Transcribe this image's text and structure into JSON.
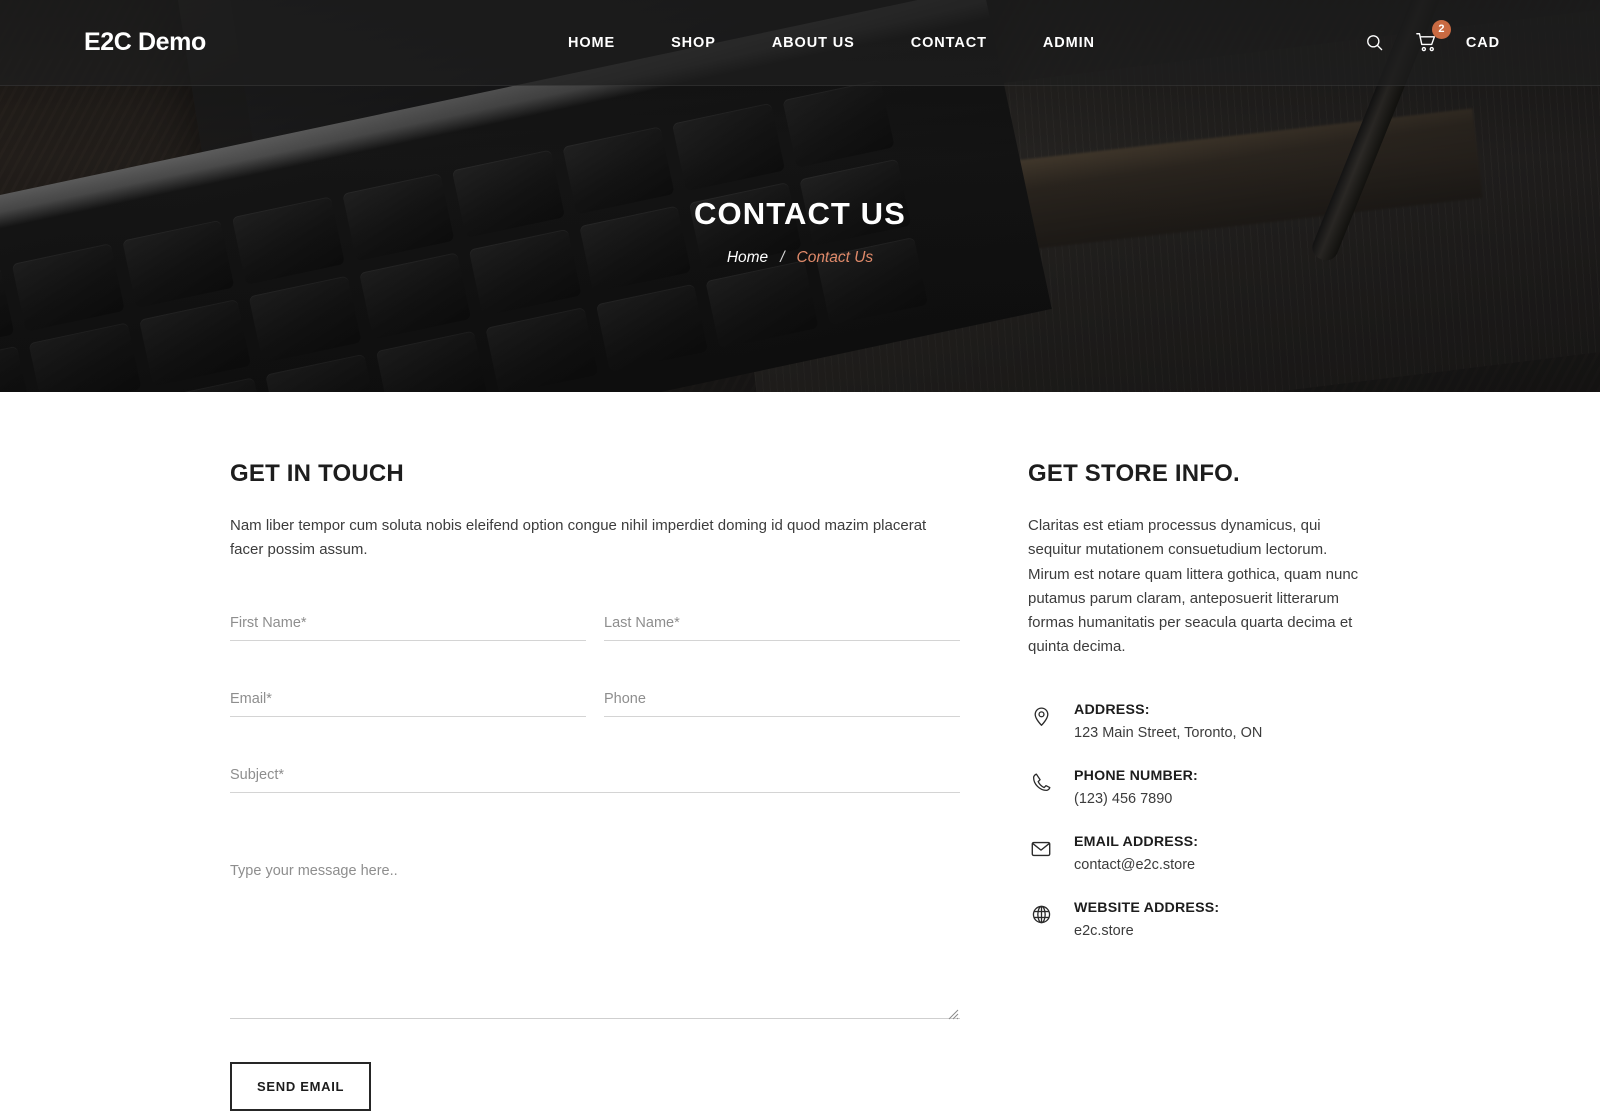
{
  "header": {
    "logo": "E2C Demo",
    "nav": [
      {
        "label": "HOME"
      },
      {
        "label": "SHOP"
      },
      {
        "label": "ABOUT US"
      },
      {
        "label": "CONTACT"
      },
      {
        "label": "ADMIN"
      }
    ],
    "search_icon": "search-icon",
    "cart_icon": "cart-icon",
    "cart_count": "2",
    "currency": "CAD",
    "badge_color": "#c96a42"
  },
  "hero": {
    "title": "CONTACT US",
    "breadcrumb": {
      "home": "Home",
      "separator": "/",
      "current": "Contact Us",
      "current_color": "#e08a6a"
    }
  },
  "get_in_touch": {
    "title": "GET IN TOUCH",
    "paragraph": "Nam liber tempor cum soluta nobis eleifend option congue nihil imperdiet doming id quod mazim placerat facer possim assum.",
    "form": {
      "first_name": {
        "placeholder": "First Name*",
        "value": ""
      },
      "last_name": {
        "placeholder": "Last Name*",
        "value": ""
      },
      "email": {
        "placeholder": "Email*",
        "value": ""
      },
      "phone": {
        "placeholder": "Phone",
        "value": ""
      },
      "subject": {
        "placeholder": "Subject*",
        "value": ""
      },
      "message": {
        "placeholder": "Type your message here..",
        "value": ""
      },
      "submit_label": "SEND EMAIL"
    }
  },
  "store_info": {
    "title": "GET STORE INFO.",
    "paragraph": "Claritas est etiam processus dynamicus, qui sequitur mutationem consuetudium lectorum. Mirum est notare quam littera gothica, quam nunc putamus parum claram, anteposuerit litterarum formas humanitatis per seacula quarta decima et quinta decima.",
    "items": [
      {
        "icon": "map-pin-icon",
        "label": "ADDRESS:",
        "value": "123 Main Street, Toronto, ON"
      },
      {
        "icon": "phone-icon",
        "label": "PHONE NUMBER:",
        "value": "(123) 456 7890"
      },
      {
        "icon": "envelope-icon",
        "label": "EMAIL ADDRESS:",
        "value": "contact@e2c.store"
      },
      {
        "icon": "globe-icon",
        "label": "WEBSITE ADDRESS:",
        "value": "e2c.store"
      }
    ]
  }
}
